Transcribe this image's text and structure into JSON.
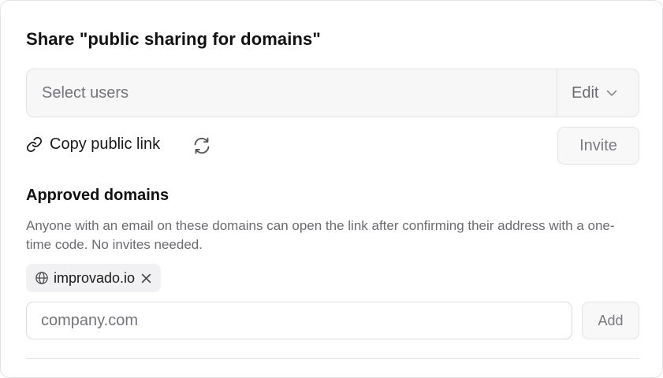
{
  "dialog": {
    "title": "Share \"public sharing for domains\""
  },
  "share": {
    "users_placeholder": "Select users",
    "permission_value": "Edit",
    "copy_link_label": "Copy public link",
    "invite_label": "Invite"
  },
  "approved_domains": {
    "heading": "Approved domains",
    "description": "Anyone with an email on these domains can open the link after confirming their address with a one-time code. No invites needed.",
    "chips": [
      {
        "label": "improvado.io"
      }
    ],
    "input_placeholder": "company.com",
    "add_label": "Add"
  },
  "icons": {
    "link": "link-icon",
    "refresh": "refresh-icon",
    "chevron": "chevron-down-icon",
    "globe": "globe-icon",
    "remove": "close-icon"
  }
}
